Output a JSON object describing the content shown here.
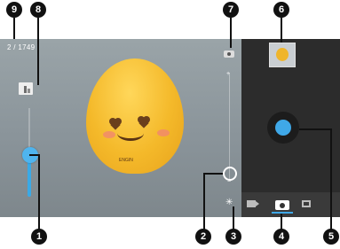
{
  "viewfinder": {
    "photo_counter": "2 / 1749",
    "egg_caption": "ENGIN"
  },
  "zoom": {
    "plus_symbol": "+",
    "minus_symbol": "−"
  },
  "callouts": [
    "1",
    "2",
    "3",
    "4",
    "5",
    "6",
    "7",
    "8",
    "9"
  ],
  "colors": {
    "accent": "#3fa8e8",
    "panel": "#2c2c2c"
  },
  "icons": {
    "switch_camera": "switch-camera-icon",
    "flash": "flash-icon",
    "video_mode": "video-mode-icon",
    "camera_mode": "camera-mode-icon",
    "panorama_mode": "panorama-mode-icon",
    "exposure": "exposure-icon"
  }
}
